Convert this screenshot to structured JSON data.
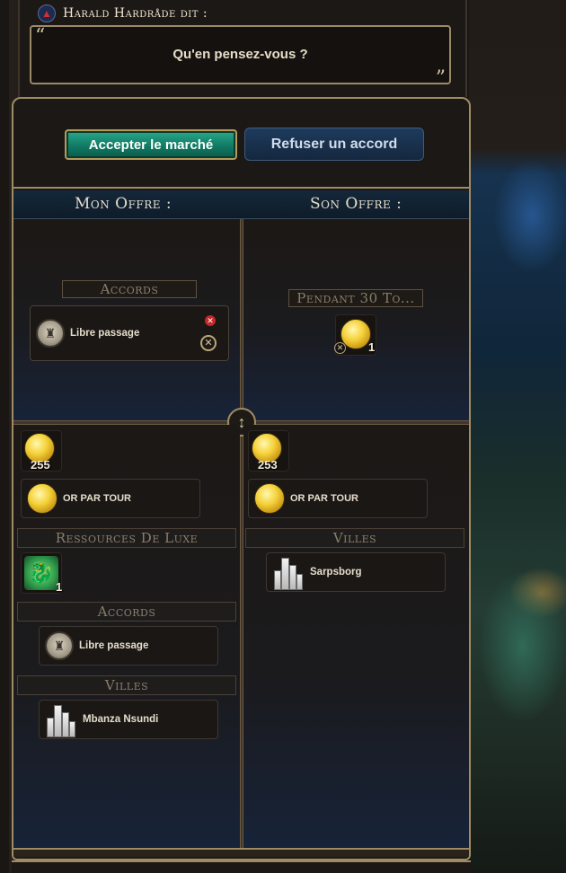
{
  "leader": {
    "name": "Harald Hardråde dit :",
    "civ_icon": "civ-emblem-icon",
    "speech": "Qu'en pensez-vous ?",
    "quote_open": "“",
    "quote_close": "”"
  },
  "actions": {
    "accept_label": "Accepter le marché",
    "refuse_label": "Refuser un accord"
  },
  "offers": {
    "mine_title": "Mon Offre :",
    "theirs_title": "Son Offre :"
  },
  "my_offer": {
    "section_title": "Accords",
    "items": [
      {
        "label": "Libre passage",
        "icon": "open-borders-icon"
      }
    ]
  },
  "their_offer": {
    "section_title": "Pendant 30 To...",
    "items": [
      {
        "icon": "gold-per-turn-icon",
        "amount": "1"
      }
    ]
  },
  "my_inventory": {
    "gold": {
      "amount": "255",
      "icon": "gold-icon"
    },
    "gold_per_turn_label": "OR PAR TOUR",
    "luxury_title": "Ressources De Luxe",
    "luxury_items": [
      {
        "icon": "jade-dragon-icon",
        "amount": "1"
      }
    ],
    "agreements_title": "Accords",
    "agreements": [
      {
        "label": "Libre passage",
        "icon": "open-borders-icon"
      }
    ],
    "cities_title": "Villes",
    "cities": [
      {
        "label": "Mbanza Nsundi",
        "icon": "city-icon"
      }
    ]
  },
  "their_inventory": {
    "gold": {
      "amount": "253",
      "icon": "gold-icon"
    },
    "gold_per_turn_label": "OR PAR TOUR",
    "cities_title": "Villes",
    "cities": [
      {
        "label": "Sarpsborg",
        "icon": "city-icon"
      }
    ]
  },
  "controls": {
    "divider_handle": "↕",
    "remove_glyph": "✕"
  },
  "colors": {
    "accept_green": "#117a64",
    "refuse_blue": "#1e3a5c",
    "frame_gold": "#a08c64",
    "gold_coin": "#f5d23a"
  }
}
